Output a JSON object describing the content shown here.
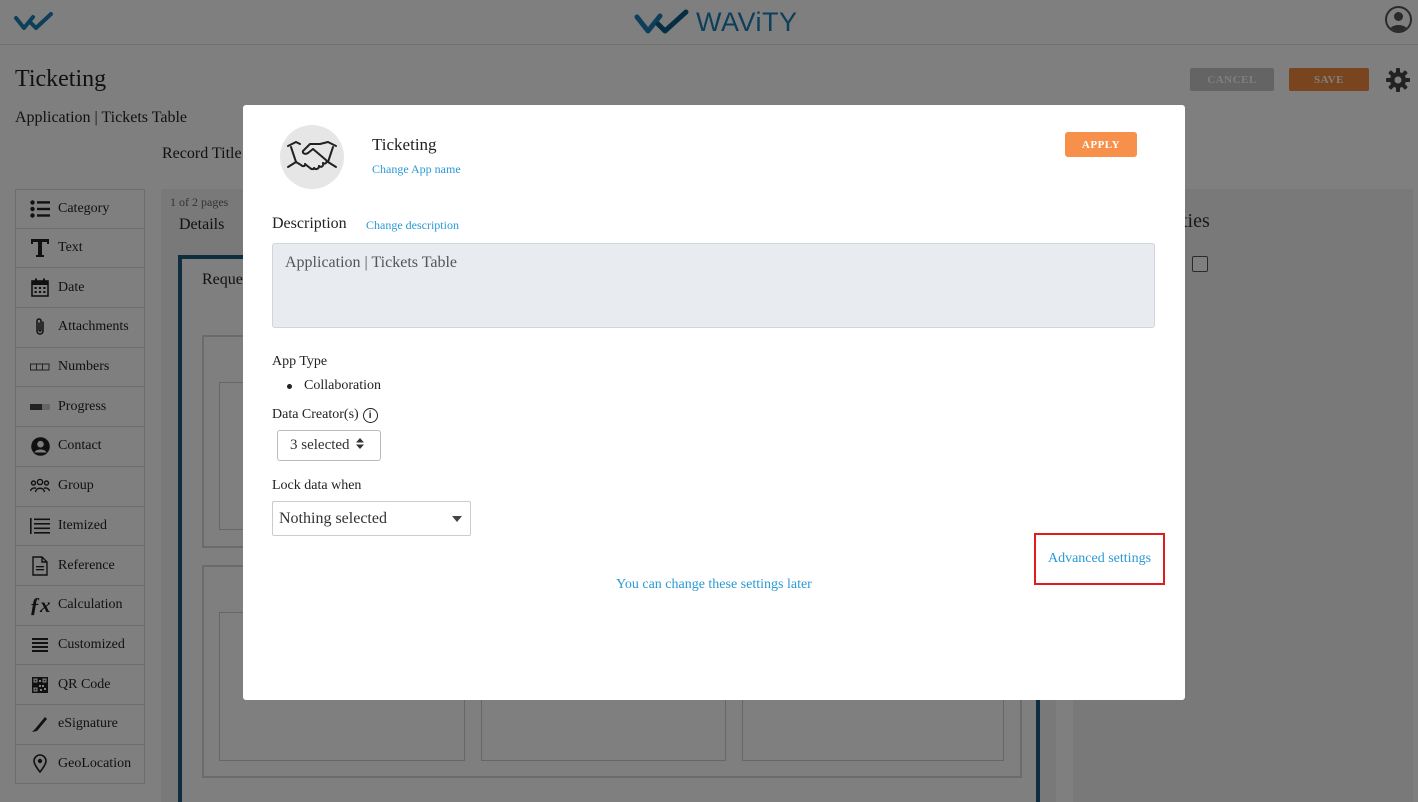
{
  "header": {
    "brand_name": "WAViTY"
  },
  "page": {
    "title": "Ticketing",
    "subtitle": "Application | Tickets Table",
    "record_title": "Record Title",
    "cancel_label": "CANCEL",
    "save_label": "SAVE"
  },
  "palette": {
    "items": [
      {
        "label": "Category",
        "icon": "list-icon"
      },
      {
        "label": "Text",
        "icon": "text-t-icon"
      },
      {
        "label": "Date",
        "icon": "calendar-icon"
      },
      {
        "label": "Attachments",
        "icon": "paperclip-icon"
      },
      {
        "label": "Numbers",
        "icon": "number-boxes-icon"
      },
      {
        "label": "Progress",
        "icon": "progress-bar-icon"
      },
      {
        "label": "Contact",
        "icon": "user-circle-icon"
      },
      {
        "label": "Group",
        "icon": "group-icon"
      },
      {
        "label": "Itemized",
        "icon": "itemized-list-icon"
      },
      {
        "label": "Reference",
        "icon": "document-icon"
      },
      {
        "label": "Calculation",
        "icon": "fx-icon"
      },
      {
        "label": "Customized",
        "icon": "menu-lines-icon"
      },
      {
        "label": "QR Code",
        "icon": "qr-code-icon"
      },
      {
        "label": "eSignature",
        "icon": "pen-icon"
      },
      {
        "label": "GeoLocation",
        "icon": "map-pin-icon"
      }
    ]
  },
  "canvas": {
    "pages_label": "1 of 2 pages",
    "tab_label": "Details",
    "section_label": "Reque"
  },
  "properties": {
    "title": "ties"
  },
  "modal": {
    "app_name": "Ticketing",
    "change_app_name": "Change App name",
    "apply_label": "APPLY",
    "description_label": "Description",
    "change_description": "Change description",
    "description_value": "Application | Tickets Table",
    "app_type_label": "App Type",
    "app_type_value": "Collaboration",
    "data_creators_label": "Data Creator(s)",
    "data_creators_value": "3 selected",
    "lock_label": "Lock data when",
    "lock_value": "Nothing selected",
    "advanced_settings": "Advanced settings",
    "later_note": "You can change these settings later"
  },
  "colors": {
    "accent_orange": "#f08a3e",
    "link_blue": "#2a9ad6",
    "brand_blue": "#1a7fb5",
    "highlight_red": "#e21b1b"
  }
}
